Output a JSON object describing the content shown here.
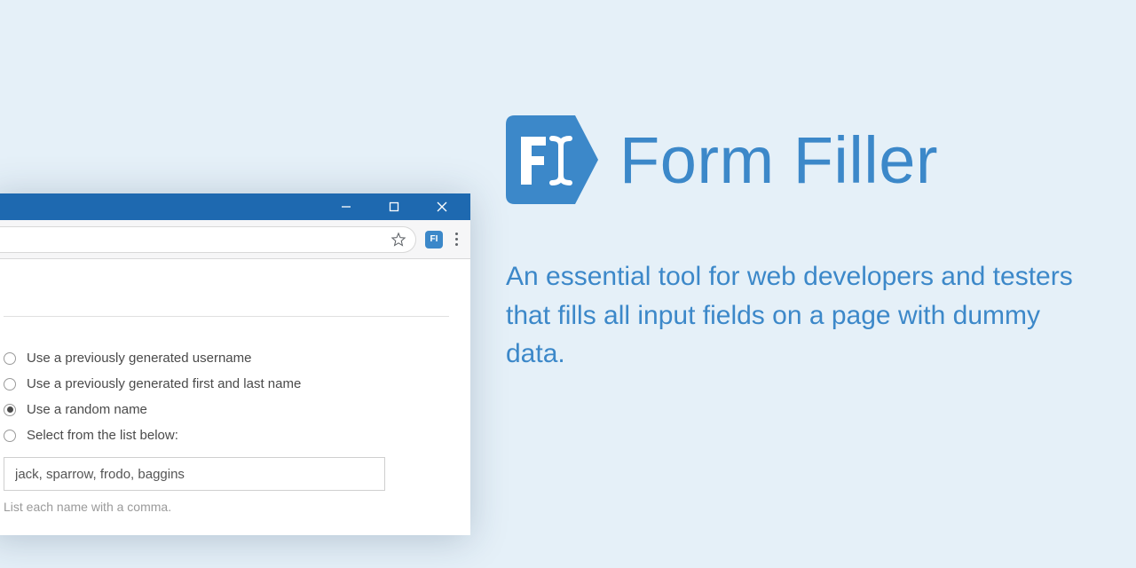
{
  "hero": {
    "title": "Form Filler",
    "tagline": "An essential tool for web developers and testers that fills all input fields on a page with dummy data.",
    "logo_text": "FI"
  },
  "browser": {
    "options": [
      {
        "label": "Use a previously generated username",
        "checked": false
      },
      {
        "label": "Use a previously generated first and last name",
        "checked": false
      },
      {
        "label": "Use a random name",
        "checked": true
      },
      {
        "label": "Select from the list below:",
        "checked": false
      }
    ],
    "name_list_value": "jack, sparrow, frodo, baggins",
    "hint": "List each name with a comma.",
    "ext_badge": "FI"
  }
}
